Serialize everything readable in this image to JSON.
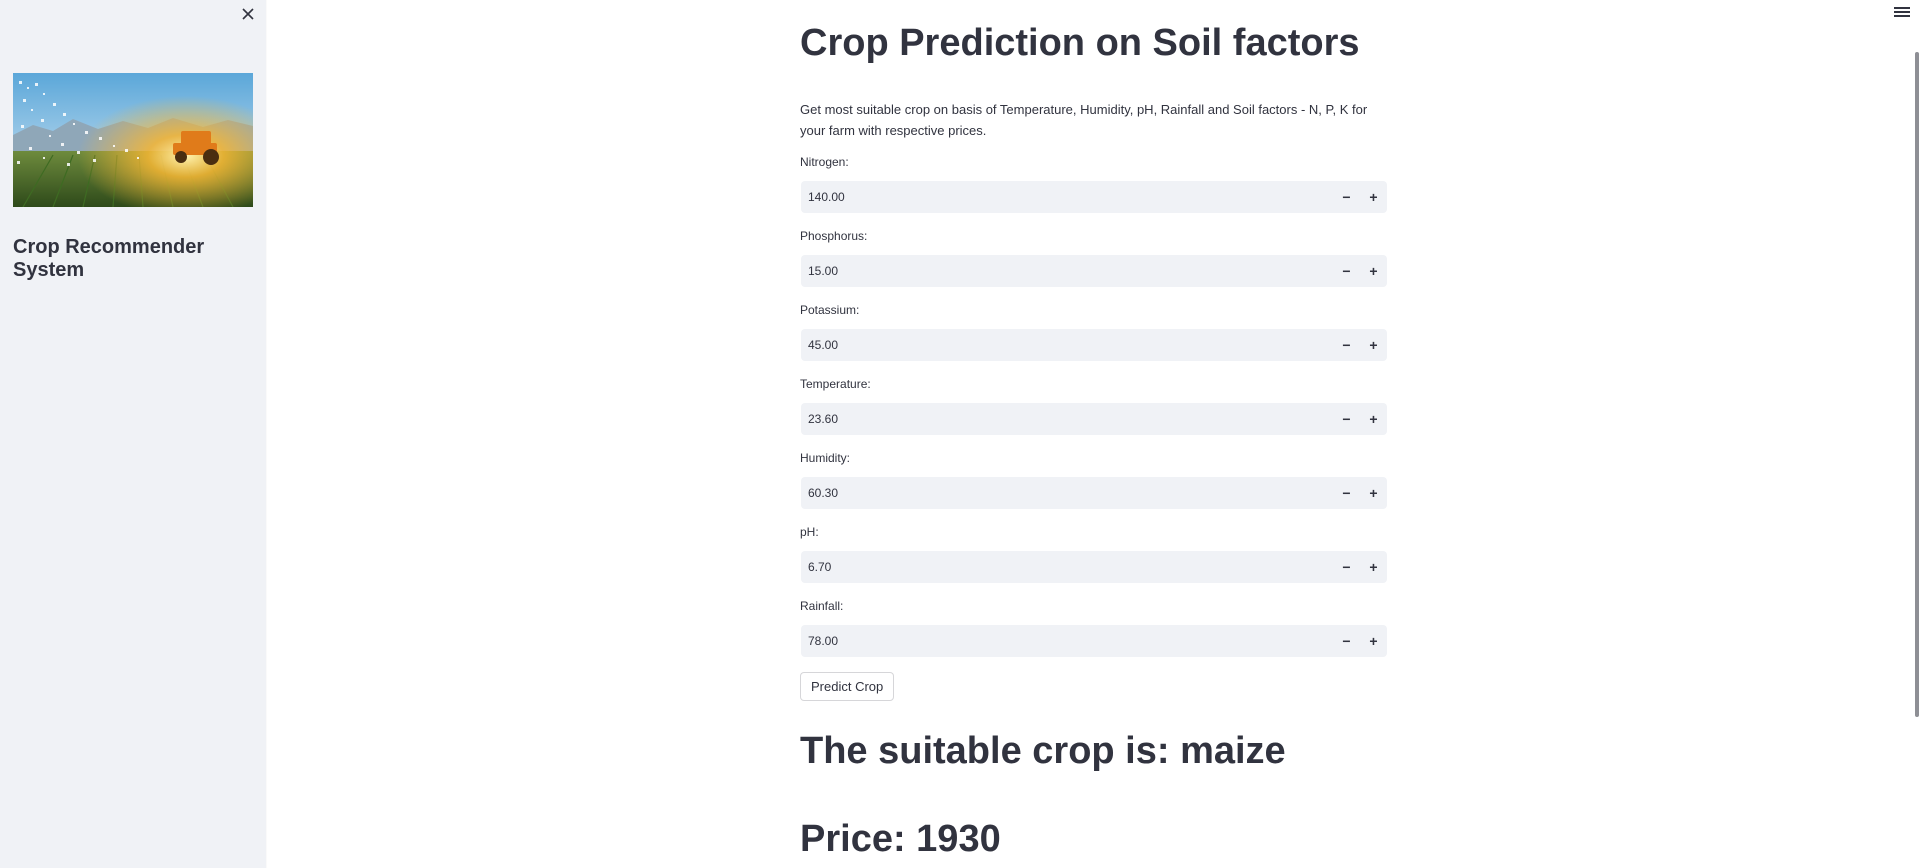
{
  "sidebar": {
    "title": "Crop Recommender System",
    "banner_image": "farm-field-tractor-sunset"
  },
  "main": {
    "title": "Crop Prediction on Soil factors",
    "description": "Get most suitable crop on basis of Temperature, Humidity, pH, Rainfall and Soil factors - N, P, K for your farm with respective prices.",
    "inputs": [
      {
        "label": "Nitrogen:",
        "value": "140.00"
      },
      {
        "label": "Phosphorus:",
        "value": "15.00"
      },
      {
        "label": "Potassium:",
        "value": "45.00"
      },
      {
        "label": "Temperature:",
        "value": "23.60"
      },
      {
        "label": "Humidity:",
        "value": "60.30"
      },
      {
        "label": "pH:",
        "value": "6.70"
      },
      {
        "label": "Rainfall:",
        "value": "78.00"
      }
    ],
    "stepper_minus": "−",
    "stepper_plus": "+",
    "predict_button": "Predict Crop",
    "result": "The suitable crop is: maize",
    "price": "Price: 1930"
  },
  "icons": {
    "close": "close-icon",
    "menu": "hamburger-menu-icon"
  },
  "colors": {
    "sidebar_bg": "#F0F2F6",
    "text": "#31333F",
    "input_bg": "#F0F2F6"
  }
}
